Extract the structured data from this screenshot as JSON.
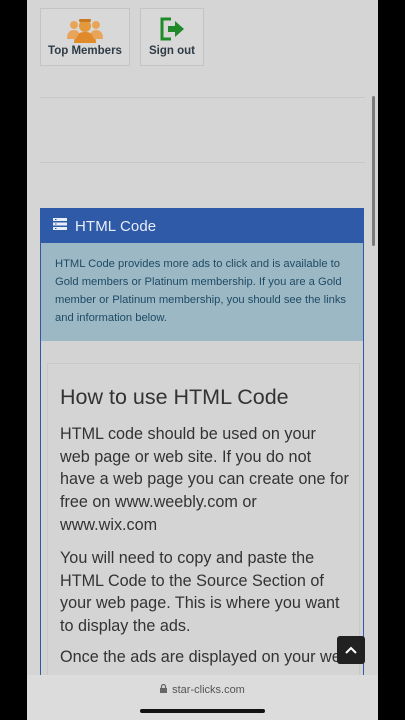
{
  "tiles": [
    {
      "label": "Top Members",
      "icon": "users-icon"
    },
    {
      "label": "Sign out",
      "icon": "sign-out-icon"
    }
  ],
  "panel": {
    "title": "HTML Code",
    "icon": "list-icon",
    "info": "HTML Code provides more ads to click and is available to Gold members or Platinum membership. If you are a Gold member or Platinum membership, you should see the links and information below."
  },
  "content": {
    "heading": "How to use HTML Code",
    "paragraphs": [
      "HTML code should be used on your web page or web site. If you do not have a web page you can create one for free on www.weebly.com or www.wix.com",
      "You will need to copy and paste the HTML Code to the Source Section of your web page. This is where you want to display the ads.",
      "Once the ads are displayed on your web page"
    ]
  },
  "browser": {
    "url": "star-clicks.com"
  },
  "colors": {
    "panel_header": "#2f5aa8",
    "info_background": "#9db8c5",
    "signout_icon": "#1f8a2a",
    "members_icon": "#e08a2a"
  }
}
